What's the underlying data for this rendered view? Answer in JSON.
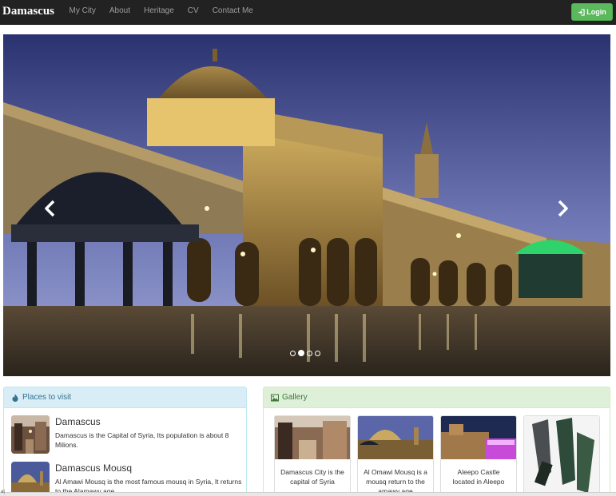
{
  "navbar": {
    "brand": "Damascus",
    "links": [
      "My City",
      "About",
      "Heritage",
      "CV",
      "Contact Me"
    ],
    "login_label": "Login"
  },
  "carousel": {
    "slide_count": 4,
    "active_index": 1
  },
  "places": {
    "heading": "Places to visit",
    "items": [
      {
        "title": "Damascus",
        "text": "Damascus is the Capital of Syria, Its population is about 8 Milions."
      },
      {
        "title": "Damascus Mousq",
        "text": "Al Amawi Mousq is the most famous mousq in Syria, It returns to the Alamawy age."
      }
    ]
  },
  "gallery": {
    "heading": "Gallery",
    "items": [
      {
        "caption": "Damascus City is the capital of Syria"
      },
      {
        "caption": "Al Omawi Mousq is a mousq return to the amawy age"
      },
      {
        "caption": "Aleepo Castle located in Aleepo"
      },
      {
        "caption": ""
      }
    ]
  },
  "status_bar": {
    "text": "a|"
  },
  "colors": {
    "navbar_bg": "#222222",
    "login_green": "#5cb85c",
    "info_heading_bg": "#d9edf7",
    "success_heading_bg": "#dff0d8"
  },
  "icons": [
    "log-in-icon",
    "fire-icon",
    "picture-icon",
    "chevron-left-icon",
    "chevron-right-icon"
  ]
}
